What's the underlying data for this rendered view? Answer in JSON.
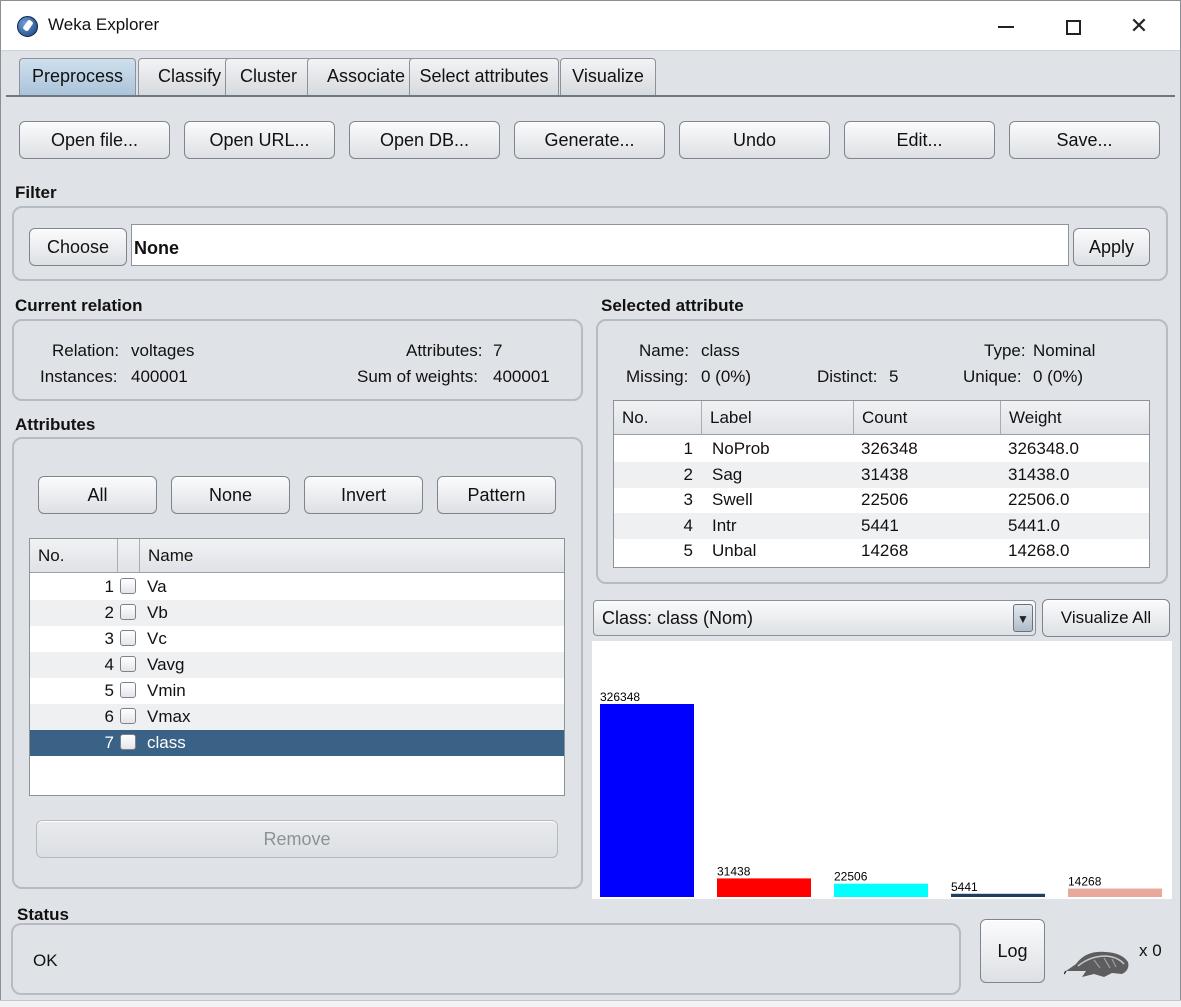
{
  "window": {
    "title": "Weka Explorer"
  },
  "tabs": [
    "Preprocess",
    "Classify",
    "Cluster",
    "Associate",
    "Select attributes",
    "Visualize"
  ],
  "toolbar": [
    "Open file...",
    "Open URL...",
    "Open DB...",
    "Generate...",
    "Undo",
    "Edit...",
    "Save..."
  ],
  "filter": {
    "label": "Filter",
    "choose": "Choose",
    "value": "None",
    "apply": "Apply"
  },
  "relation": {
    "label": "Current relation",
    "relation_key": "Relation:",
    "relation_val": "voltages",
    "instances_key": "Instances:",
    "instances_val": "400001",
    "attributes_key": "Attributes:",
    "attributes_val": "7",
    "sow_key": "Sum of weights:",
    "sow_val": "400001"
  },
  "attributes": {
    "label": "Attributes",
    "buttons": [
      "All",
      "None",
      "Invert",
      "Pattern"
    ],
    "col_no": "No.",
    "col_name": "Name",
    "rows": [
      {
        "no": "1",
        "name": "Va"
      },
      {
        "no": "2",
        "name": "Vb"
      },
      {
        "no": "3",
        "name": "Vc"
      },
      {
        "no": "4",
        "name": "Vavg"
      },
      {
        "no": "5",
        "name": "Vmin"
      },
      {
        "no": "6",
        "name": "Vmax"
      },
      {
        "no": "7",
        "name": "class"
      }
    ],
    "selected_index": 6,
    "remove": "Remove"
  },
  "selected_attribute": {
    "label": "Selected attribute",
    "name_key": "Name:",
    "name_val": "class",
    "type_key": "Type:",
    "type_val": "Nominal",
    "missing_key": "Missing:",
    "missing_val": "0 (0%)",
    "distinct_key": "Distinct:",
    "distinct_val": "5",
    "unique_key": "Unique:",
    "unique_val": "0 (0%)",
    "columns": [
      "No.",
      "Label",
      "Count",
      "Weight"
    ],
    "rows": [
      {
        "no": "1",
        "label": "NoProb",
        "count": "326348",
        "weight": "326348.0"
      },
      {
        "no": "2",
        "label": "Sag",
        "count": "31438",
        "weight": "31438.0"
      },
      {
        "no": "3",
        "label": "Swell",
        "count": "22506",
        "weight": "22506.0"
      },
      {
        "no": "4",
        "label": "Intr",
        "count": "5441",
        "weight": "5441.0"
      },
      {
        "no": "5",
        "label": "Unbal",
        "count": "14268",
        "weight": "14268.0"
      }
    ]
  },
  "class_select": {
    "value": "Class: class (Nom)",
    "visualize_all": "Visualize All"
  },
  "chart_data": {
    "type": "bar",
    "categories": [
      "NoProb",
      "Sag",
      "Swell",
      "Intr",
      "Unbal"
    ],
    "values": [
      326348,
      31438,
      22506,
      5441,
      14268
    ],
    "colors": [
      "#0000ff",
      "#ff0000",
      "#00ffff",
      "#1f3f5f",
      "#e8a89a"
    ],
    "data_labels": true
  },
  "status": {
    "label": "Status",
    "text": "OK",
    "log": "Log",
    "count": "x 0"
  }
}
